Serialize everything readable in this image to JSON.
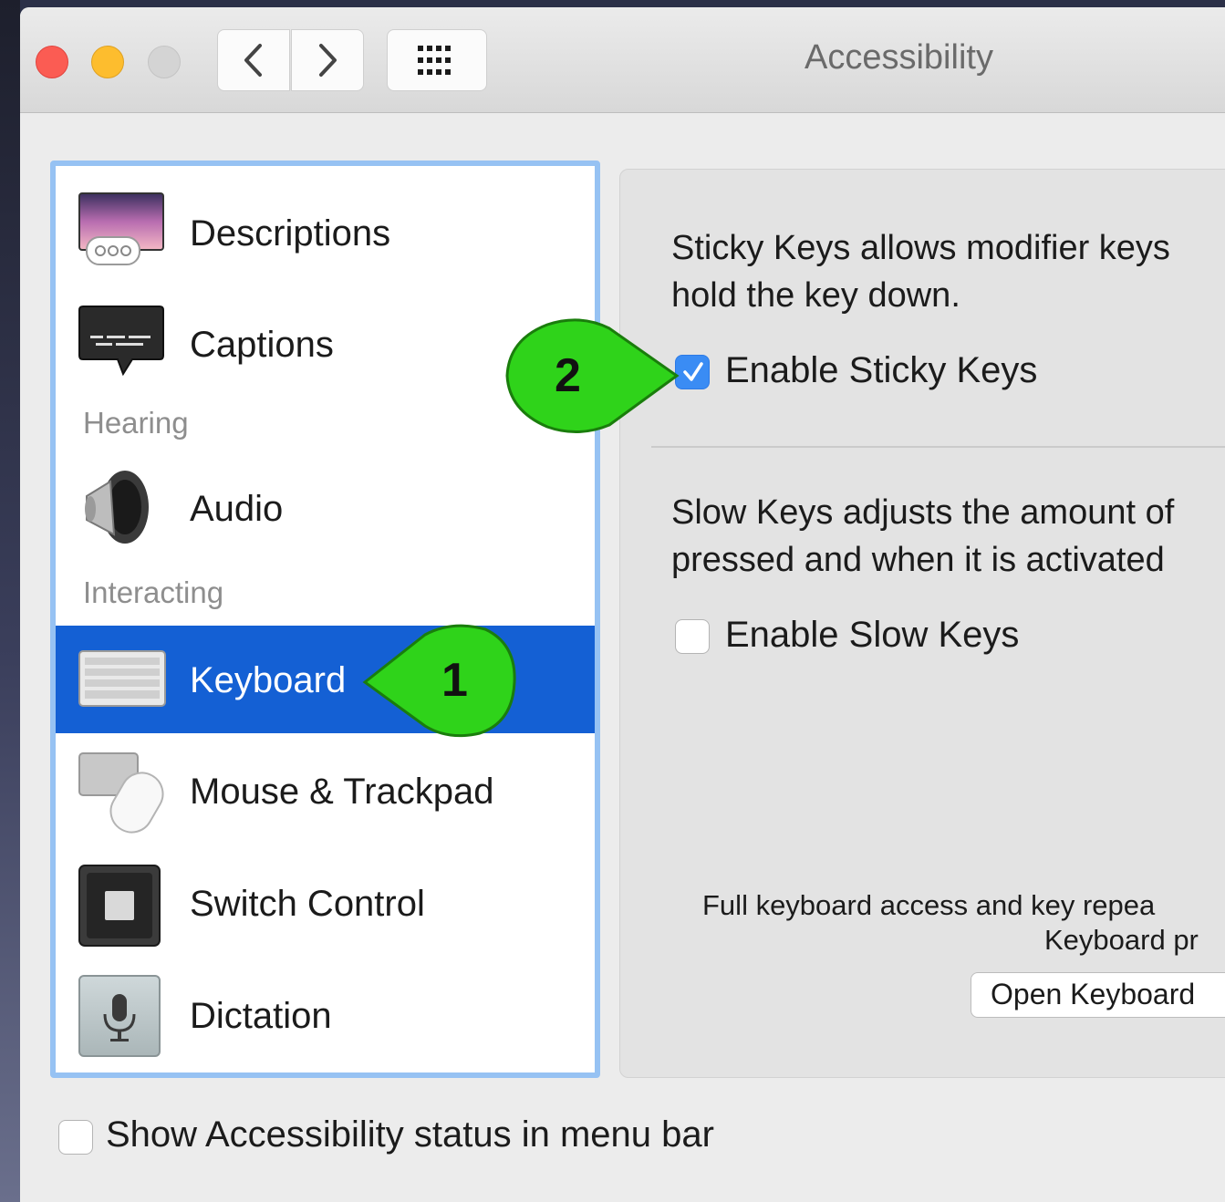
{
  "window": {
    "title": "Accessibility"
  },
  "toolbar": {
    "back_icon": "chevron-left-icon",
    "forward_icon": "chevron-right-icon",
    "grid_icon": "grid-icon"
  },
  "sidebar": {
    "items": [
      {
        "label": "Descriptions",
        "icon": "descriptions-icon"
      },
      {
        "label": "Captions",
        "icon": "captions-icon"
      },
      {
        "label": "Audio",
        "icon": "speaker-icon"
      },
      {
        "label": "Keyboard",
        "icon": "keyboard-icon",
        "selected": true
      },
      {
        "label": "Mouse & Trackpad",
        "icon": "mouse-icon"
      },
      {
        "label": "Switch Control",
        "icon": "switch-control-icon"
      },
      {
        "label": "Dictation",
        "icon": "microphone-icon"
      }
    ],
    "sections": {
      "hearing": "Hearing",
      "interacting": "Interacting"
    }
  },
  "panel": {
    "sticky_desc_line1": "Sticky Keys allows modifier keys",
    "sticky_desc_line2": "hold the key down.",
    "sticky_checkbox_label": "Enable Sticky Keys",
    "sticky_checked": true,
    "slow_desc_line1": "Slow Keys adjusts the amount of",
    "slow_desc_line2": "pressed and when it is activated",
    "slow_checkbox_label": "Enable Slow Keys",
    "slow_checked": false,
    "note_line1": "Full keyboard access and key repea",
    "note_line2": "Keyboard pr",
    "open_button_label": "Open Keyboard"
  },
  "footer": {
    "status_checkbox_label": "Show Accessibility status in menu bar",
    "status_checked": false
  },
  "callouts": {
    "one": "1",
    "two": "2",
    "color": "#2fd31a"
  },
  "colors": {
    "selection": "#1460d4",
    "checkbox_checked": "#3a8cf4",
    "sidebar_border": "#96c2f3"
  }
}
